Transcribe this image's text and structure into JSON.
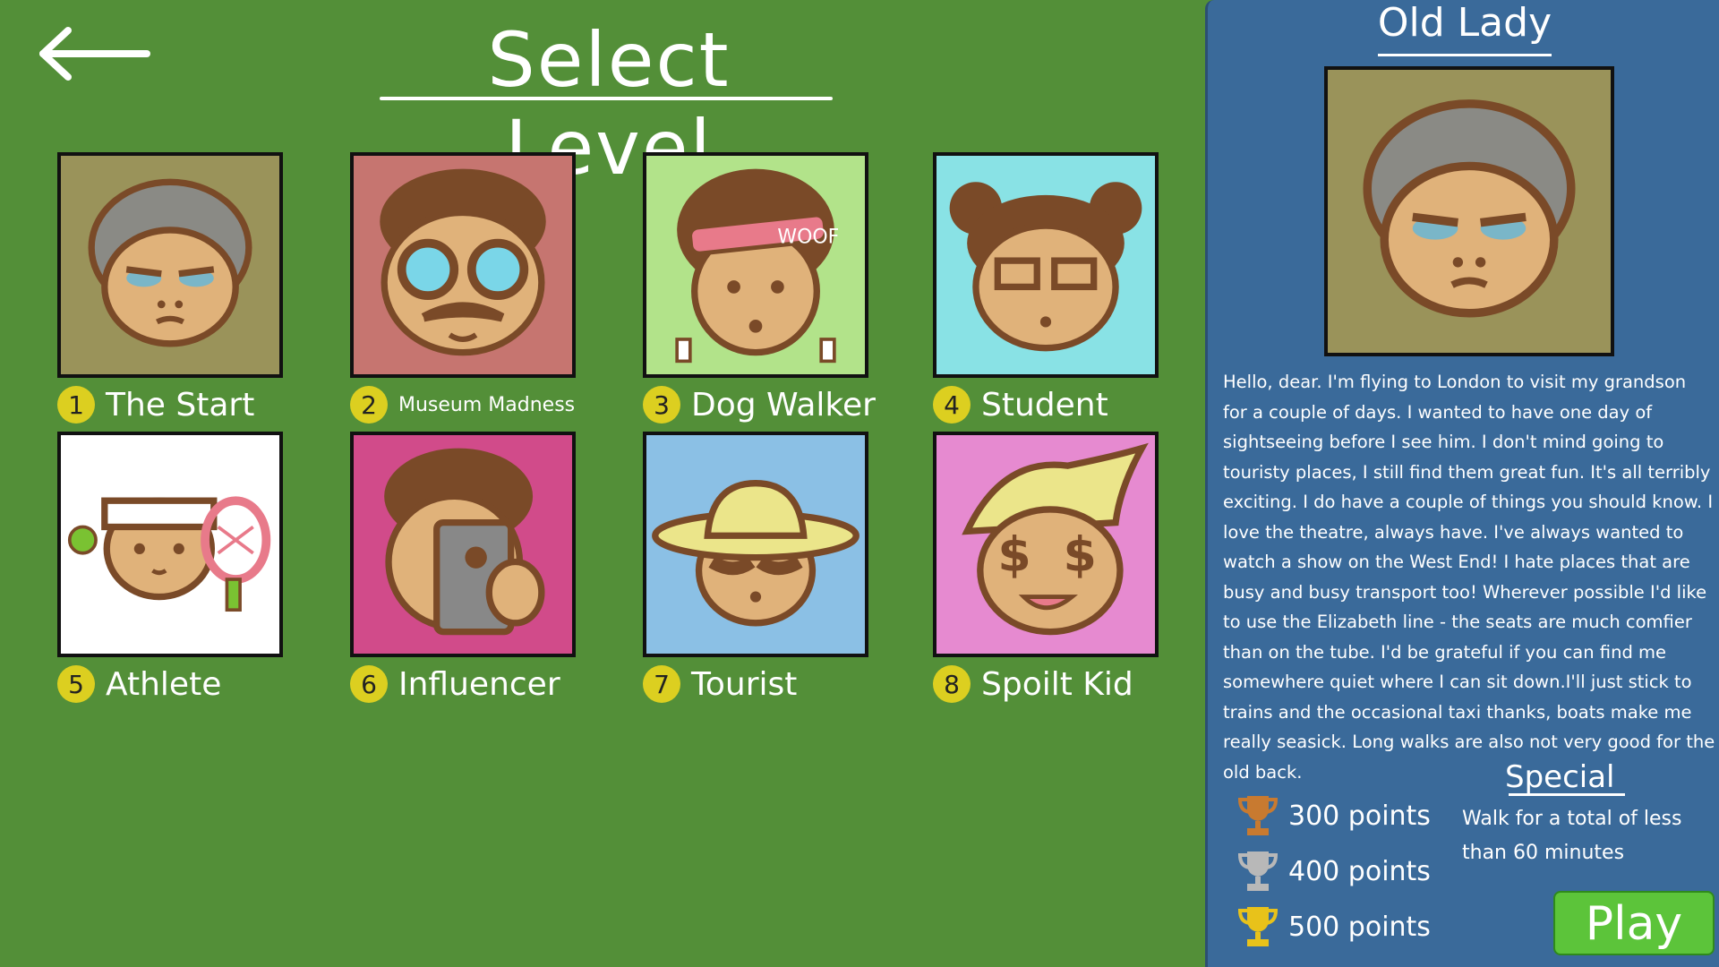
{
  "header": {
    "title": "Select Level",
    "back_icon": "back-arrow-icon"
  },
  "levels": [
    {
      "num": "1",
      "name": "The Start",
      "bg": "#9a935a",
      "icon": "old-lady-portrait-icon"
    },
    {
      "num": "2",
      "name": "Museum Madness",
      "bg": "#c67570",
      "icon": "museum-man-portrait-icon"
    },
    {
      "num": "3",
      "name": "Dog Walker",
      "bg": "#b2e38a",
      "icon": "dog-walker-portrait-icon"
    },
    {
      "num": "4",
      "name": "Student",
      "bg": "#89e2e5",
      "icon": "student-portrait-icon"
    },
    {
      "num": "5",
      "name": "Athlete",
      "bg": "#ffffff",
      "icon": "athlete-portrait-icon"
    },
    {
      "num": "6",
      "name": "Influencer",
      "bg": "#d14b8a",
      "icon": "influencer-portrait-icon"
    },
    {
      "num": "7",
      "name": "Tourist",
      "bg": "#8bc0e5",
      "icon": "tourist-portrait-icon"
    },
    {
      "num": "8",
      "name": "Spoilt Kid",
      "bg": "#e68ad0",
      "icon": "spoilt-kid-portrait-icon"
    }
  ],
  "detail": {
    "title": "Old Lady",
    "description": "Hello, dear. I'm flying to London to visit my grandson for a couple of days. I wanted to have one day of sightseeing before I see him. I don't mind going to touristy places, I still find them great fun. It's all terribly exciting. I do have a couple of things you should know. I love the theatre, always have. I've always wanted to watch a show on the West End! I hate places that are busy and busy transport too! Wherever possible I'd like to use the Elizabeth line - the seats are much comfier than on the tube. I'd be grateful if you can find me somewhere quiet where I can sit down.I'll just stick to trains and the occasional taxi thanks, boats make me really seasick. Long walks are also not very good for the old back.",
    "trophies": [
      {
        "label": "300 points",
        "color": "#c87a30",
        "icon": "bronze-trophy-icon"
      },
      {
        "label": "400 points",
        "color": "#b8b8b8",
        "icon": "silver-trophy-icon"
      },
      {
        "label": "500 points",
        "color": "#e8c21a",
        "icon": "gold-trophy-icon"
      }
    ],
    "special_title": "Special",
    "special_text": "Walk for a total of less than 60 minutes",
    "play_label": "Play"
  },
  "colors": {
    "background": "#538f38",
    "panel": "#3a6a9a",
    "play": "#5cc43a",
    "number_badge": "#dccf20"
  }
}
